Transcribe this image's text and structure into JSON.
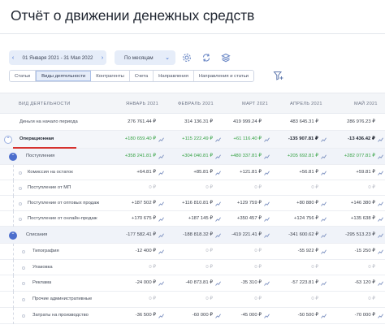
{
  "title": "Отчёт о движении денежных средств",
  "toolbar": {
    "date_range": "01 Января 2021 - 31 Мая 2022",
    "period": "По месяцам"
  },
  "tabs": [
    "Статьи",
    "Виды деятельности",
    "Контрагенты",
    "Счета",
    "Направления",
    "Направления и статьи"
  ],
  "active_tab": "Виды деятельности",
  "table": {
    "first_col_header": "ВИД ДЕЯТЕЛЬНОСТИ",
    "month_headers": [
      "ЯНВАРЬ 2021",
      "ФЕВРАЛЬ 2021",
      "МАРТ 2021",
      "АПРЕЛЬ 2021",
      "МАЙ 2021"
    ],
    "rows": [
      {
        "label": "Деньги на начало периода",
        "values": [
          "276 761.44 ₽",
          "314 136.31 ₽",
          "419 999.24 ₽",
          "483 645.31 ₽",
          "286 976.23 ₽"
        ]
      },
      {
        "label": "Операционная",
        "values": [
          "+180 659.40 ₽",
          "+115 222.49 ₽",
          "+61 116.40 ₽",
          "-135 907.81 ₽",
          "-13 436.42 ₽"
        ]
      },
      {
        "label": "Поступления",
        "values": [
          "+358 241.81 ₽",
          "+304 040.81 ₽",
          "+480 337.81 ₽",
          "+205 692.81 ₽",
          "+282 077.81 ₽"
        ]
      },
      {
        "label": "Комиссия на остаток",
        "values": [
          "+64.81 ₽",
          "+85.81 ₽",
          "+121.81 ₽",
          "+56.81 ₽",
          "+59.81 ₽"
        ]
      },
      {
        "label": "Поступление от МП",
        "values": [
          "0 ₽",
          "0 ₽",
          "0 ₽",
          "0 ₽",
          "0 ₽"
        ]
      },
      {
        "label": "Поступление от оптовых продаж",
        "values": [
          "+187 502 ₽",
          "+116 810.81 ₽",
          "+129 759 ₽",
          "+80 880 ₽",
          "+146 380 ₽"
        ]
      },
      {
        "label": "Поступление от онлайн-продаж",
        "values": [
          "+170 675 ₽",
          "+187 145 ₽",
          "+350 457 ₽",
          "+124 756 ₽",
          "+135 638 ₽"
        ]
      },
      {
        "label": "Списания",
        "values": [
          "-177 582.41 ₽",
          "-188 818.32 ₽",
          "-419 221.41 ₽",
          "-341 600.62 ₽",
          "-295 513.23 ₽"
        ]
      },
      {
        "label": "Типография",
        "values": [
          "-12 400 ₽",
          "0 ₽",
          "0 ₽",
          "-55 922 ₽",
          "-15 250 ₽"
        ]
      },
      {
        "label": "Упаковка",
        "values": [
          "0 ₽",
          "0 ₽",
          "0 ₽",
          "0 ₽",
          "0 ₽"
        ]
      },
      {
        "label": "Реклама",
        "values": [
          "-24 000 ₽",
          "-40 873.81 ₽",
          "-35 310 ₽",
          "-57 223.81 ₽",
          "-63 120 ₽"
        ]
      },
      {
        "label": "Прочие административные",
        "values": [
          "0 ₽",
          "0 ₽",
          "0 ₽",
          "0 ₽",
          "0 ₽"
        ]
      },
      {
        "label": "Затраты на производство",
        "values": [
          "-36 500 ₽",
          "-60 000 ₽",
          "-45 000 ₽",
          "-50 500 ₽",
          "-70 000 ₽"
        ]
      }
    ]
  },
  "colors": {
    "accent": "#4c6ecd",
    "positive": "#37a346",
    "underline": "#d6322f"
  }
}
